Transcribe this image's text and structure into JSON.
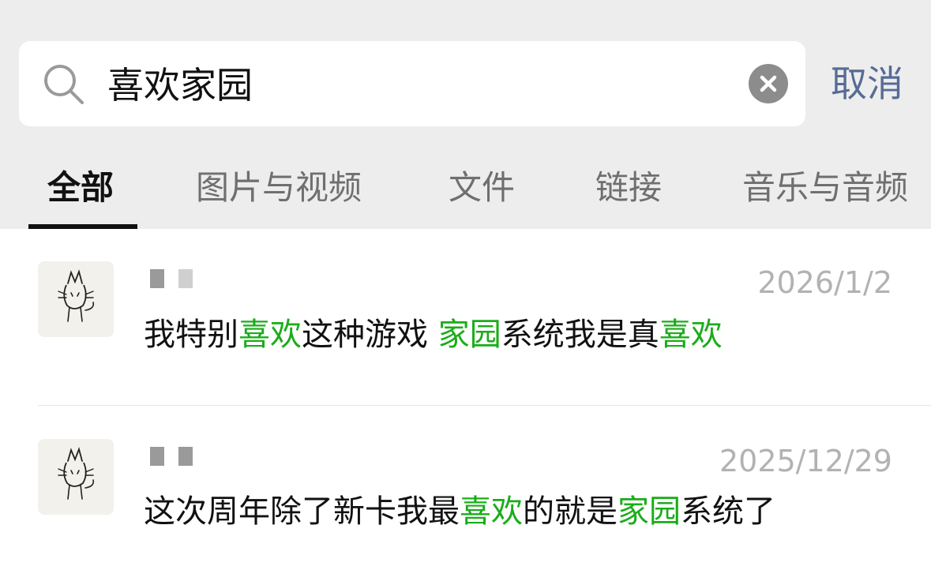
{
  "search": {
    "query": "喜欢家园",
    "cancel_label": "取消"
  },
  "tabs": [
    {
      "label": "全部",
      "active": true
    },
    {
      "label": "图片与视频",
      "active": false
    },
    {
      "label": "文件",
      "active": false
    },
    {
      "label": "链接",
      "active": false
    },
    {
      "label": "音乐与音频",
      "active": false
    }
  ],
  "results": [
    {
      "date": "2026/1/2",
      "message": [
        {
          "text": "我特别",
          "highlight": false
        },
        {
          "text": "喜欢",
          "highlight": true
        },
        {
          "text": "这种游戏 ",
          "highlight": false
        },
        {
          "text": "家园",
          "highlight": true
        },
        {
          "text": "系统我是真",
          "highlight": false
        },
        {
          "text": "喜欢",
          "highlight": true
        }
      ]
    },
    {
      "date": "2025/12/29",
      "message": [
        {
          "text": "这次周年除了新卡我最",
          "highlight": false
        },
        {
          "text": "喜欢",
          "highlight": true
        },
        {
          "text": "的就是",
          "highlight": false
        },
        {
          "text": "家园",
          "highlight": true
        },
        {
          "text": "系统了",
          "highlight": false
        }
      ]
    }
  ],
  "colors": {
    "highlight": "#1aad19",
    "cancel": "#576b95",
    "header_bg": "#ededed"
  }
}
